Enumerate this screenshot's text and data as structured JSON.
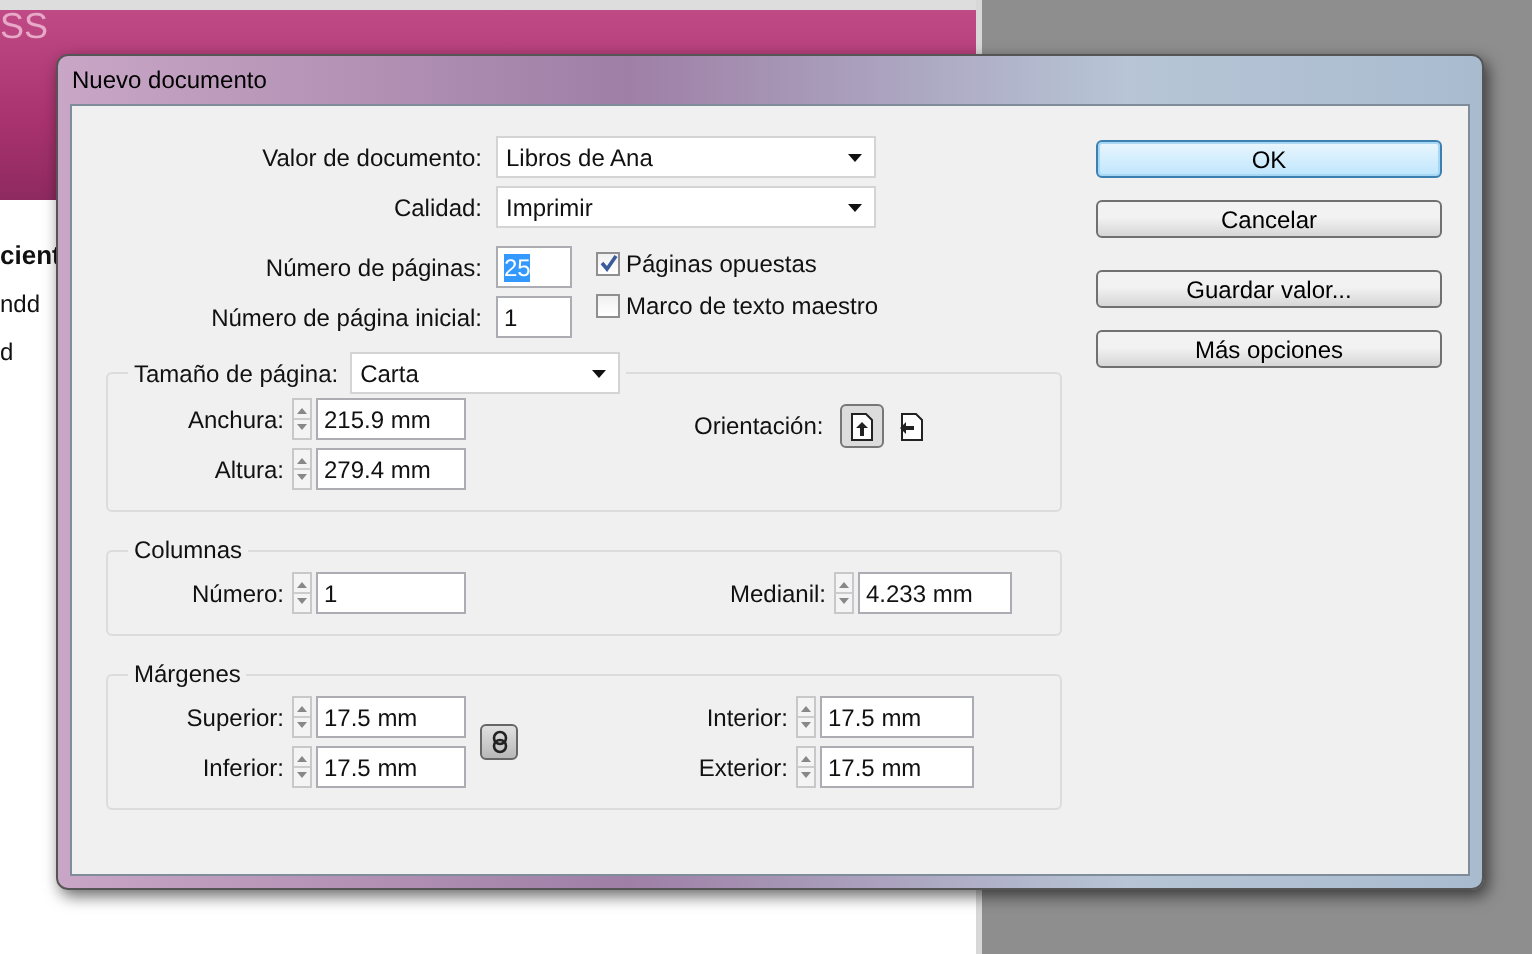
{
  "background": {
    "fragments": [
      {
        "text": "SS",
        "kind": "brand"
      },
      {
        "text": "cient",
        "kind": "heading"
      },
      {
        "text": "ndd",
        "kind": "item"
      },
      {
        "text": "d",
        "kind": "item"
      }
    ]
  },
  "dialog": {
    "title": "Nuevo documento",
    "preset": {
      "label": "Valor de documento:",
      "value": "Libros de Ana"
    },
    "intent": {
      "label": "Calidad:",
      "value": "Imprimir"
    },
    "pages": {
      "label": "Número de páginas:",
      "value": "25",
      "selected": true
    },
    "start_page": {
      "label": "Número de página inicial:",
      "value": "1",
      "selected": false
    },
    "options": [
      {
        "label": "Páginas opuestas",
        "checked": true
      },
      {
        "label": "Marco de texto maestro",
        "checked": false
      }
    ],
    "page_size": {
      "label": "Tamaño de página:",
      "value": "Carta",
      "fields": [
        {
          "label": "Anchura:",
          "value": "215.9 mm"
        },
        {
          "label": "Altura:",
          "value": "279.4 mm"
        }
      ],
      "orientation": {
        "label": "Orientación:",
        "options": [
          {
            "kind": "portrait",
            "selected": true
          },
          {
            "kind": "landscape",
            "selected": false
          }
        ]
      }
    },
    "columns": {
      "title": "Columnas",
      "number": {
        "label": "Número:",
        "value": "1"
      },
      "gutter": {
        "label": "Medianil:",
        "value": "4.233 mm"
      }
    },
    "margins": {
      "title": "Márgenes",
      "fields": [
        {
          "label": "Superior:",
          "value": "17.5 mm"
        },
        {
          "label": "Inferior:",
          "value": "17.5 mm"
        },
        {
          "label": "Interior:",
          "value": "17.5 mm"
        },
        {
          "label": "Exterior:",
          "value": "17.5 mm"
        }
      ]
    },
    "buttons": [
      {
        "label": "OK",
        "default": true
      },
      {
        "label": "Cancelar",
        "default": false
      },
      {
        "label": "Guardar valor...",
        "default": false
      },
      {
        "label": "Más opciones",
        "default": false
      }
    ]
  }
}
